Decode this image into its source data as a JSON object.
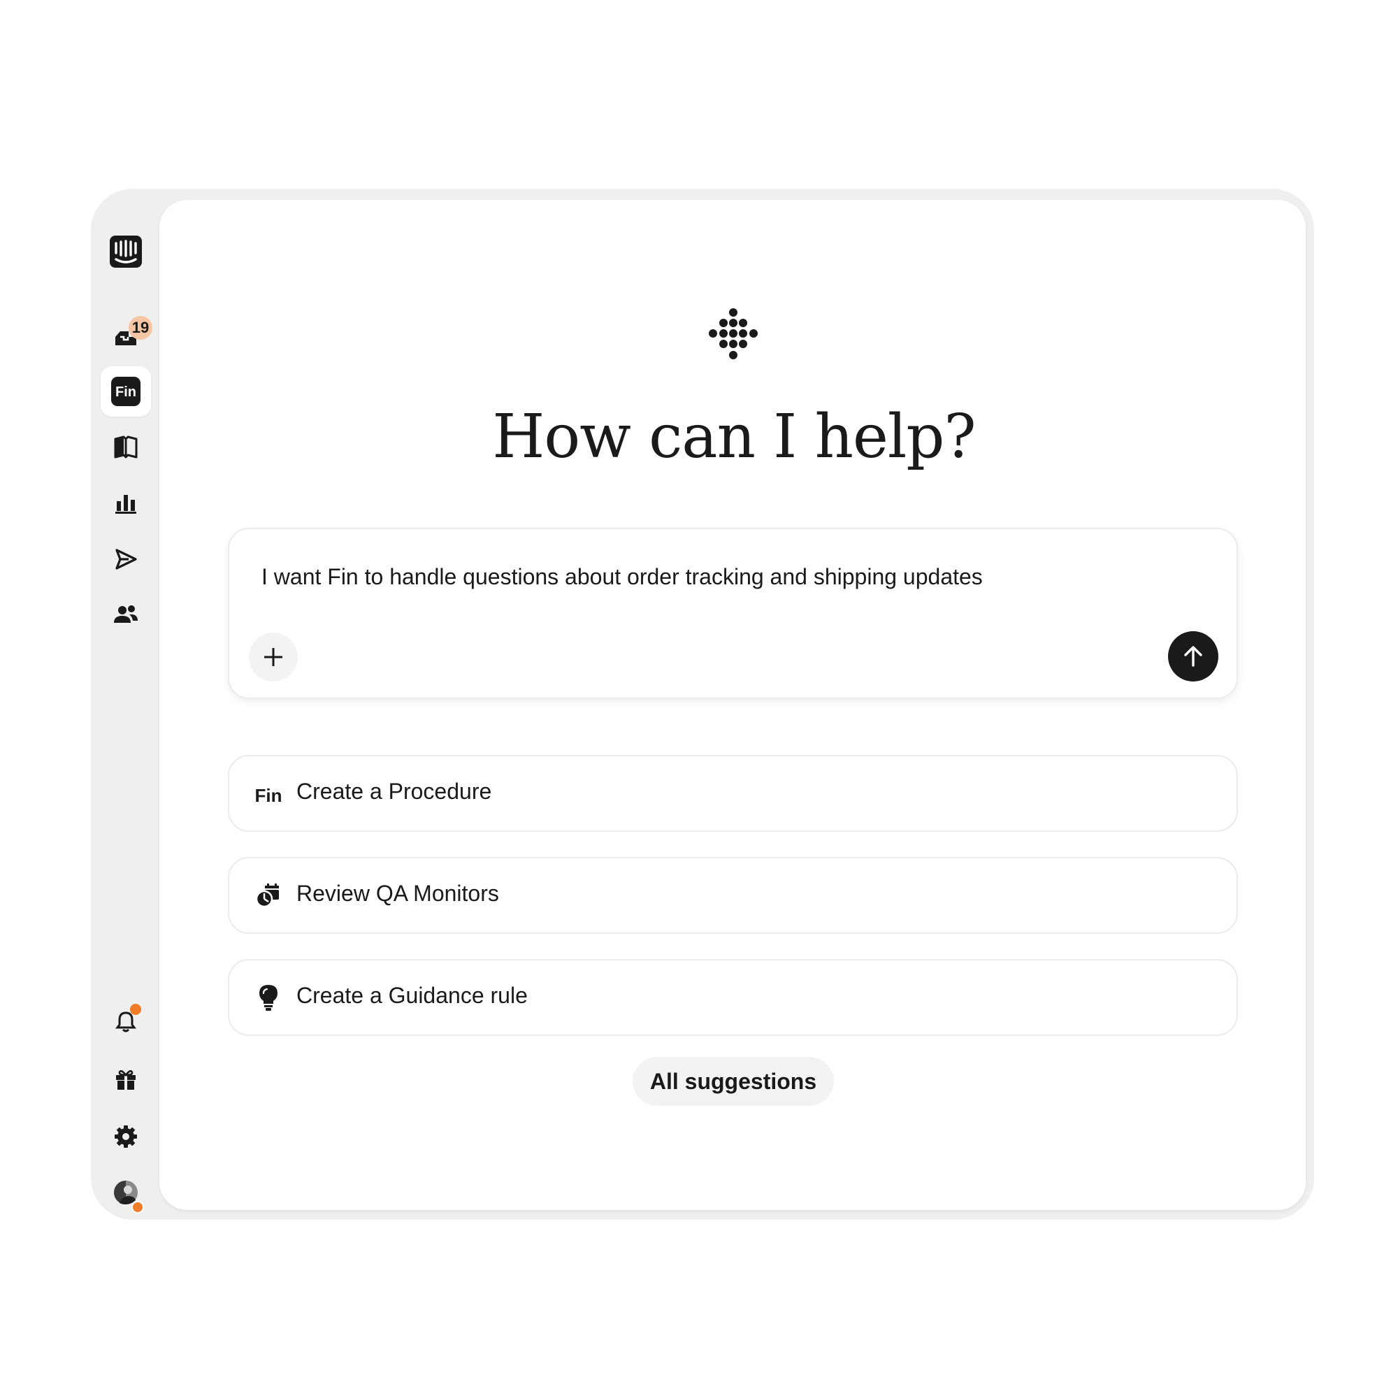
{
  "sidebar": {
    "items": [
      {
        "icon": "intercom-logo-icon"
      },
      {
        "icon": "inbox-icon",
        "badge": "19"
      },
      {
        "icon": "fin-icon",
        "label": "Fin",
        "active": true
      },
      {
        "icon": "knowledge-book-icon"
      },
      {
        "icon": "reports-chart-icon"
      },
      {
        "icon": "outbound-send-icon"
      },
      {
        "icon": "contacts-people-icon"
      }
    ],
    "bottom_items": [
      {
        "icon": "notifications-bell-icon",
        "has_dot": true
      },
      {
        "icon": "gift-icon"
      },
      {
        "icon": "settings-gear-icon"
      },
      {
        "icon": "user-avatar",
        "has_status_dot": true
      }
    ],
    "badge_color": "#f6c6a4",
    "dot_color": "#f07c2a"
  },
  "main": {
    "brand_icon": "fin-dots-logo-icon",
    "headline": "How can I help?",
    "composer": {
      "text": "I want Fin to handle questions about order tracking and shipping updates",
      "plus_icon": "plus-icon",
      "send_icon": "arrow-up-icon"
    },
    "suggestions": [
      {
        "icon": "fin-text-icon",
        "icon_text": "Fin",
        "label": "Create a Procedure"
      },
      {
        "icon": "qa-monitor-icon",
        "label": "Review QA Monitors"
      },
      {
        "icon": "lightbulb-icon",
        "label": "Create a Guidance rule"
      }
    ],
    "all_suggestions_label": "All suggestions"
  },
  "colors": {
    "frame_bg": "#efefed",
    "panel_bg": "#ffffff",
    "text": "#1a1a1a",
    "border": "#ececec"
  }
}
